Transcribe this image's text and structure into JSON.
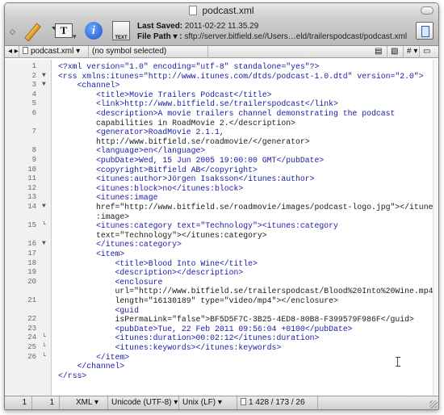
{
  "window": {
    "title": "podcast.xml"
  },
  "toolbar": {
    "text_button": "T",
    "info_button": "i",
    "book_label": "TEXT",
    "last_saved_label": "Last Saved:",
    "last_saved_value": "2011-02-22 11.35.29",
    "file_path_label": "File Path ▾ :",
    "file_path_value": "sftp://server.bitfield.se//Users…eld/trailerspodcast/podcast.xml"
  },
  "navbar": {
    "file_name": "podcast.xml",
    "symbol": "(no symbol selected)",
    "hash": "#"
  },
  "editor": {
    "line_numbers": [
      "1",
      "2",
      "3",
      "4",
      "5",
      "6",
      "7",
      "8",
      "9",
      "10",
      "11",
      "12",
      "13",
      "14",
      "15",
      "16",
      "17",
      "18",
      "19",
      "20",
      "21",
      "22",
      "23",
      "24",
      "25",
      "26"
    ],
    "fold_markers": [
      {
        "line": "2",
        "glyph": "▼"
      },
      {
        "line": "3",
        "glyph": "▼"
      },
      {
        "line": "14",
        "glyph": "▼"
      },
      {
        "line": "15",
        "glyph": "└"
      },
      {
        "line": "16",
        "glyph": "▼"
      },
      {
        "line": "24",
        "glyph": "└"
      },
      {
        "line": "25",
        "glyph": "└"
      },
      {
        "line": "26",
        "glyph": "└"
      }
    ],
    "code_lines": [
      "<?xml version=\"1.0\" encoding=\"utf-8\" standalone=\"yes\"?>",
      "<rss xmlns:itunes=\"http://www.itunes.com/dtds/podcast-1.0.dtd\" version=\"2.0\">",
      "    <channel>",
      "        <title>Movie Trailers Podcast</title>",
      "        <link>http://www.bitfield.se/trailerspodcast</link>",
      "        <description>A movie trailers channel demonstrating the podcast",
      "        capabilities in RoadMovie 2.</description>",
      "        <generator>RoadMovie 2.1.1,",
      "        http://www.bitfield.se/roadmovie/</generator>",
      "        <language>en</language>",
      "        <pubDate>Wed, 15 Jun 2005 19:00:00 GMT</pubDate>",
      "        <copyright>Bitfield AB</copyright>",
      "        <itunes:author>Jörgen Isaksson</itunes:author>",
      "        <itunes:block>no</itunes:block>",
      "        <itunes:image",
      "        href=\"http://www.bitfield.se/roadmovie/images/podcast-logo.jpg\"></itunes",
      "        :image>",
      "        <itunes:category text=\"Technology\"><itunes:category",
      "        text=\"Technology\"></itunes:category>",
      "        </itunes:category>",
      "        <item>",
      "            <title>Blood Into Wine</title>",
      "            <description></description>",
      "            <enclosure",
      "            url=\"http://www.bitfield.se/trailerspodcast/Blood%20Into%20Wine.mp4\"",
      "            length=\"16130189\" type=\"video/mp4\"></enclosure>",
      "            <guid",
      "            isPermaLink=\"false\">BF5D5F7C-3B25-4ED8-80B8-F399579F986F</guid>",
      "            <pubDate>Tue, 22 Feb 2011 09:56:04 +0100</pubDate>",
      "            <itunes:duration>00:02:12</itunes:duration>",
      "            <itunes:keywords></itunes:keywords>",
      "        </item>",
      "    </channel>",
      "</rss>"
    ]
  },
  "statusbar": {
    "line": "1",
    "column": "1",
    "language": "XML",
    "encoding": "Unicode (UTF-8)",
    "line_endings": "Unix (LF)",
    "stats": "1 428 / 173 / 26"
  }
}
